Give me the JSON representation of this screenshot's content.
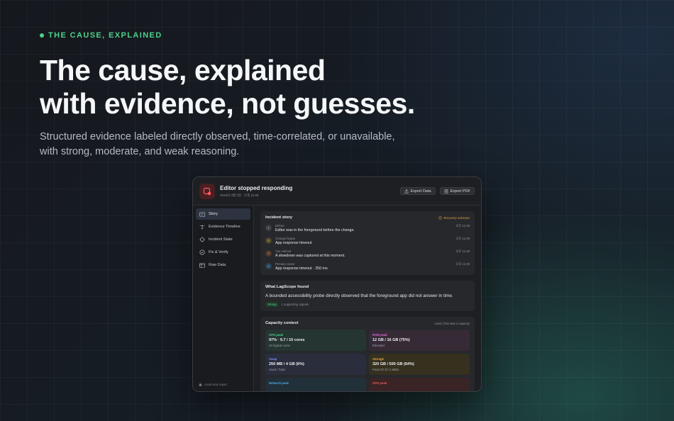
{
  "hero": {
    "eyebrow": "THE CAUSE, EXPLAINED",
    "headline_1": "The cause, explained",
    "headline_2": "with evidence, not guesses.",
    "sub_1": "Structured evidence labeled directly observed, time-correlated, or unavailable,",
    "sub_2": "with strong, moderate, and weak reasoning."
  },
  "window": {
    "title": "Editor stopped responding",
    "date": "2026년 3월 2일 · 오후 11:09",
    "export_data": "Export Data",
    "export_pdf": "Export PDF"
  },
  "sidebar": {
    "items": [
      {
        "label": "Story",
        "icon": "story-icon"
      },
      {
        "label": "Evidence Timeline",
        "icon": "timeline-icon"
      },
      {
        "label": "Incident State",
        "icon": "state-icon"
      },
      {
        "label": "Fix & Verify",
        "icon": "check-icon"
      },
      {
        "label": "Raw Data",
        "icon": "table-icon"
      }
    ],
    "footer": "Local-only report"
  },
  "story": {
    "title": "Incident story",
    "status": "Recovery unknown",
    "rows": [
      {
        "n": "1",
        "stage": "Before",
        "text": "Editor was in the foreground before the change.",
        "time": "오후 11:09",
        "color": "#8f949c"
      },
      {
        "n": "2",
        "stage": "Change began",
        "text": "App response timeout",
        "time": "오후 11:09",
        "color": "#e0b442"
      },
      {
        "n": "3",
        "stage": "You noticed",
        "text": "A slowdown was captured at this moment.",
        "time": "오후 11:09",
        "color": "#e07b42"
      },
      {
        "n": "4",
        "stage": "Primary cause",
        "text": "App response timeout · 250 ms",
        "time": "오후 11:09",
        "color": "#4aa8e0"
      }
    ]
  },
  "found": {
    "title": "What LagScope found",
    "text": "A bounded accessibility probe directly observed that the foreground app did not answer in time.",
    "badge": "Strong",
    "signals": "1 supporting signals"
  },
  "capacity": {
    "title": "Capacity context",
    "note": "Used | this Mac's capacity",
    "cells": [
      {
        "label": "CPU peak",
        "value": "97% · 9.7 / 10 cores",
        "note": "10 logical cores",
        "color": "#4fd18a",
        "bg": "#253532"
      },
      {
        "label": "RAM peak",
        "value": "12 GB / 16 GB (75%)",
        "note": "Elevated",
        "color": "#d86ad0",
        "bg": "#362a37"
      },
      {
        "label": "Swap",
        "value": "256 MB / 4 GB (6%)",
        "note": "Used / Total",
        "color": "#7a8cf0",
        "bg": "#2a2d3c"
      },
      {
        "label": "Storage",
        "value": "320 GB / 500 GB (64%)",
        "note": "Peak I/O 57.2 MB/s",
        "color": "#e0a442",
        "bg": "#36301f"
      },
      {
        "label": "Network peak",
        "value": "",
        "note": "",
        "color": "#4aa8e0",
        "bg": "#22303a"
      },
      {
        "label": "GPU peak",
        "value": "",
        "note": "",
        "color": "#e05a5a",
        "bg": "#3a2425"
      }
    ]
  }
}
